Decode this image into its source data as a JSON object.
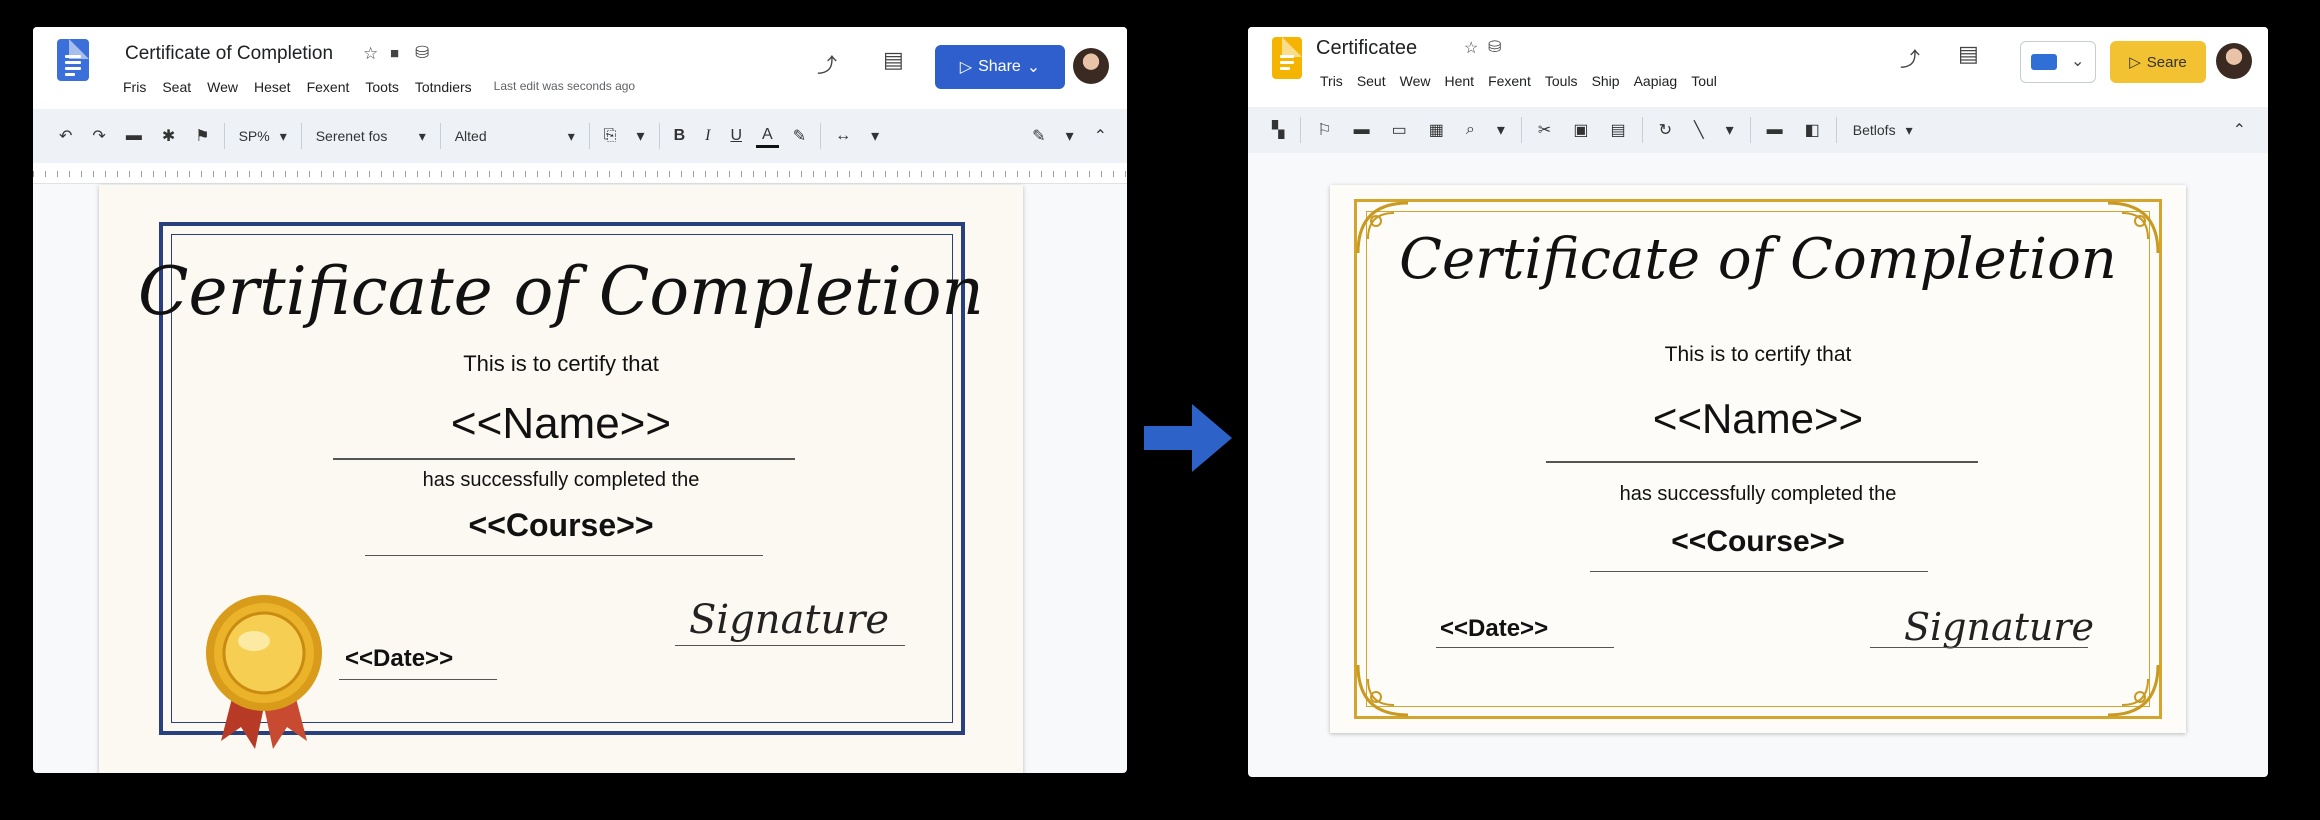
{
  "left": {
    "title": "Certificate of Completion",
    "menu": [
      "Fris",
      "Seat",
      "Wew",
      "Heset",
      "Fexent",
      "Toots",
      "Totndiers"
    ],
    "last_edit": "Last edit was seconds ago",
    "share_label": "Share",
    "toolbar": {
      "zoom": "SP%",
      "style": "Serenet fos",
      "font": "Alted",
      "bold": "B",
      "italic": "I",
      "underline": "U",
      "textcolor": "A"
    },
    "certificate": {
      "heading": "Certificate of Completion",
      "certify": "This is to certify that",
      "name": "<<Name>>",
      "completed": "has successfully completed the",
      "course": "<<Course>>",
      "date": "<<Date>>",
      "signature": "Signature"
    },
    "colors": {
      "border": "#2a3f7e",
      "share": "#2f5fcc",
      "doc_icon": "#3b6fd9"
    }
  },
  "right": {
    "title": "Certificatee",
    "menu": [
      "Tris",
      "Seut",
      "Wew",
      "Hent",
      "Fexent",
      "Touls",
      "Ship",
      "Aapiag",
      "Toul"
    ],
    "share_label": "Seare",
    "toolbar": {
      "dropdown": "Betlofs"
    },
    "certificate": {
      "heading": "Certificate of Completion",
      "certify": "This is to certify that",
      "name": "<<Name>>",
      "completed": "has successfully completed the",
      "course": "<<Course>>",
      "date": "<<Date>>",
      "signature": "Signature"
    },
    "colors": {
      "border": "#d4a52c",
      "share": "#f2c232",
      "doc_icon": "#f4b400"
    }
  },
  "arrow_color": "#2d63c8"
}
